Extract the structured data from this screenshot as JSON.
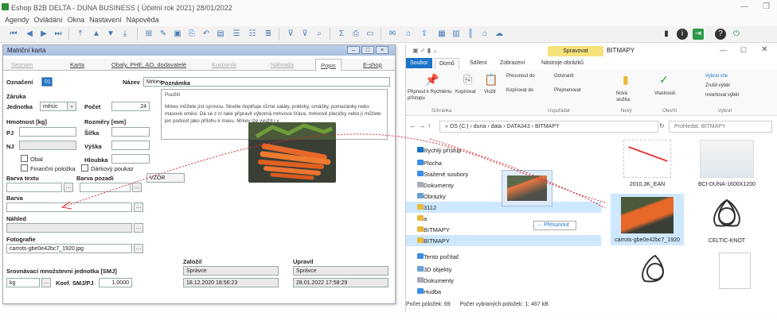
{
  "app": {
    "title": "Eshop B2B DELTA - DUNA BUSINESS ( Účetní rok 2021)   28/01/2022",
    "menu": [
      "Agendy",
      "Ovládání",
      "Okna",
      "Nastavení",
      "Nápověda"
    ]
  },
  "card": {
    "title": "Matriční karta",
    "tabs": [
      "Seznam",
      "Karta",
      "Obaly, PHE, AO, dodavatelé",
      "Kusovník",
      "Náhrada",
      "Popis",
      "E-shop"
    ],
    "active_tab": "Popis",
    "oznaceni_label": "Označení",
    "oznaceni_value": "01",
    "nazev_label": "Název",
    "nazev_value": "Mrkev",
    "zaruka_label": "Záruka",
    "jednotka_label": "Jednotka",
    "jednotka_value": "měsíc",
    "pocet_label": "Počet",
    "pocet_value": "24",
    "hmotnost_label": "Hmotnost [kg]",
    "rozmery_label": "Rozměry [mm]",
    "pj_label": "PJ",
    "sirka_label": "Šířka",
    "nj_label": "NJ",
    "vyska_label": "Výška",
    "hloubka_label": "Hloubka",
    "obal_label": "Obal",
    "financni_label": "Finanční položka",
    "darkovy_label": "Dárkový poukaz",
    "barva_textu_label": "Barva textu",
    "barva_pozadi_label": "Barva pozadí",
    "vzor_label": "VZOR",
    "barva_label": "Barva",
    "nahled_label": "Náhled",
    "fotografie_label": "Fotografie",
    "fotografie_value": "carrots-gbe0e42bc7_1920.jpg",
    "poznamka_label": "Poznámka",
    "pouziti_value": "Použití",
    "note_text": "Mrkev můžete jíst syrovou. Skvěle doplňuje různé saláty, polévky, omáčky, pomazánky nebo masové směsi. Dá se z ní také připravit výborná mrkvová šťáva, mrkvové placičky nebo jí můžete jen podusit jako přílohu k masu. Mrkev lze využít i v",
    "srovnavaci_label": "Srovnávací množstevní jednotka [SMJ]",
    "smj_unit": "kg",
    "koef_label": "Koef. SMJ/PJ",
    "koef_value": "1,0000",
    "zalozil_label": "Založil",
    "zalozil_user": "Správce",
    "zalozil_date": "18.12.2020 18:56:23",
    "upravil_label": "Upravil",
    "upravil_user": "Správce",
    "upravil_date": "28.01.2022 17:58:29"
  },
  "explorer": {
    "title": "BITMAPY",
    "context_tab": "Spravovat",
    "ribbon_tabs": [
      "Soubor",
      "Domů",
      "Sdílení",
      "Zobrazení",
      "Nástroje obrázků"
    ],
    "ribbon": {
      "pin": "Připnout k Rychlému přístupu",
      "copy": "Kopírovat",
      "paste": "Vložit",
      "move_to": "Přesunout do",
      "delete": "Odstranit",
      "copy_to": "Kopírovat do",
      "rename": "Přejmenovat",
      "new_folder": "Nová složka",
      "properties": "Vlastnosti",
      "select_all": "Vybrat vše",
      "select_none": "Zrušit výběr",
      "invert": "Invertovat výběr",
      "groups": [
        "Schránka",
        "Uspořádat",
        "Nový",
        "Otevřít",
        "Vybrat"
      ]
    },
    "address": "«  OS (C:)  ›  duna  ›  data  ›  DATA343  ›  BITMAPY",
    "search_placeholder": "Prohledat: BITMAPY",
    "nav": [
      "Rychlý přístup",
      "Plocha",
      "Stažené soubory",
      "Dokumenty",
      "Obrázky",
      "3112",
      "a",
      "BITMAPY",
      "BITMAPY",
      "Tento počítač",
      "3D objekty",
      "Dokumenty",
      "Hudba"
    ],
    "drag_tooltip": "→ Přesunout",
    "files": [
      "2010,3K_EAN",
      "BCI-DUNA-1600X1200",
      "carrots-gbe0e42bc7_1920",
      "CELTIC-KNOT"
    ],
    "status_count": "Počet položek: 69",
    "status_selected": "Počet vybraných položek: 1; 467 kB"
  },
  "colors": {
    "accent": "#1a73c9",
    "selection": "#cde8ff",
    "carrot": "#e8682a"
  }
}
